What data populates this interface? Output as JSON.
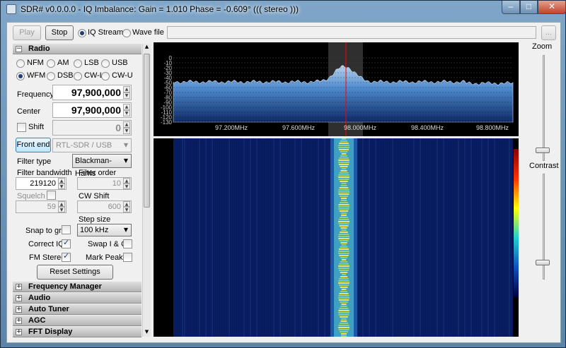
{
  "window": {
    "title": "SDR# v0.0.0.0 - IQ Imbalance: Gain = 1.010 Phase = -0.609° ((( stereo )))",
    "min": "–",
    "max": "□",
    "close": "✕"
  },
  "toolbar": {
    "play": "Play",
    "stop": "Stop",
    "iq_stream": "IQ Stream",
    "wave_file": "Wave file",
    "browse": "..."
  },
  "radio": {
    "header": "Radio",
    "modes": [
      "NFM",
      "AM",
      "LSB",
      "USB",
      "WFM",
      "DSB",
      "CW-L",
      "CW-U"
    ],
    "selected_mode": "WFM",
    "frequency_label": "Frequency",
    "frequency": "97,900,000",
    "center_label": "Center",
    "center": "97,900,000",
    "shift_label": "Shift",
    "shift": "0",
    "front_end_button": "Front end",
    "front_end": "RTL-SDR / USB",
    "filter_type_label": "Filter type",
    "filter_type": "Blackman-Harris",
    "filter_bandwidth_label": "Filter bandwidth",
    "filter_bandwidth": "219120",
    "filter_order_label": "Filter order",
    "filter_order": "10",
    "squelch_label": "Squelch",
    "squelch": "59",
    "cw_shift_label": "CW Shift",
    "cw_shift": "600",
    "step_size_label": "Step size",
    "step_size": "100 kHz",
    "snap_label": "Snap to grid",
    "correct_iq_label": "Correct IQ",
    "swap_iq_label": "Swap I & Q",
    "fm_stereo_label": "FM Stereo",
    "mark_peaks_label": "Mark Peaks",
    "reset": "Reset Settings"
  },
  "panels": [
    "Frequency Manager",
    "Audio",
    "Auto Tuner",
    "AGC",
    "FFT Display"
  ],
  "spectrum": {
    "y_ticks": [
      "0",
      "-10",
      "-20",
      "-30",
      "-40",
      "-50",
      "-60",
      "-70",
      "-80",
      "-90",
      "-100",
      "-110",
      "-120",
      "-130"
    ],
    "x_ticks": [
      "97.200MHz",
      "97.600MHz",
      "98.000MHz",
      "98.400MHz",
      "98.800MHz"
    ]
  },
  "side": {
    "zoom_label": "Zoom",
    "contrast_label": "Contrast"
  },
  "colors": {
    "background": "#000000",
    "spectrum_fill": "#3d7cc4",
    "cursor": "#ff0000",
    "passband": "#555555"
  }
}
